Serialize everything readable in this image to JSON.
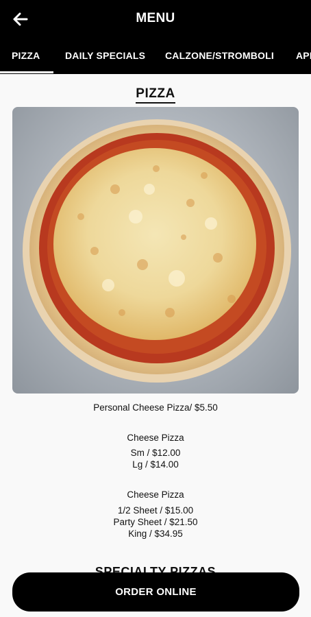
{
  "header": {
    "title": "MENU",
    "back_icon": "arrow-left-icon"
  },
  "tabs": [
    {
      "label": "PIZZA",
      "active": true
    },
    {
      "label": "DAILY SPECIALS",
      "active": false
    },
    {
      "label": "CALZONE/STROMBOLI",
      "active": false
    },
    {
      "label": "APP",
      "active": false
    }
  ],
  "section": {
    "title": "PIZZA",
    "image_alt": "Cheese pizza on a metal tray"
  },
  "items": {
    "personal": "Personal Cheese Pizza/ $5.50",
    "cheese1_title": "Cheese Pizza",
    "cheese1_sm": "Sm / $12.00",
    "cheese1_lg": "Lg / $14.00",
    "cheese2_title": "Cheese Pizza",
    "cheese2_half": "1/2  Sheet / $15.00",
    "cheese2_party": "Party  Sheet / $21.50",
    "cheese2_king": "King / $34.95"
  },
  "next_section_title": "SPECIALTY PIZZAS",
  "order_button": {
    "label": "ORDER ONLINE"
  },
  "colors": {
    "header_bg": "#000000",
    "accent_text": "#ffffff",
    "page_bg": "#f9f9f9"
  }
}
